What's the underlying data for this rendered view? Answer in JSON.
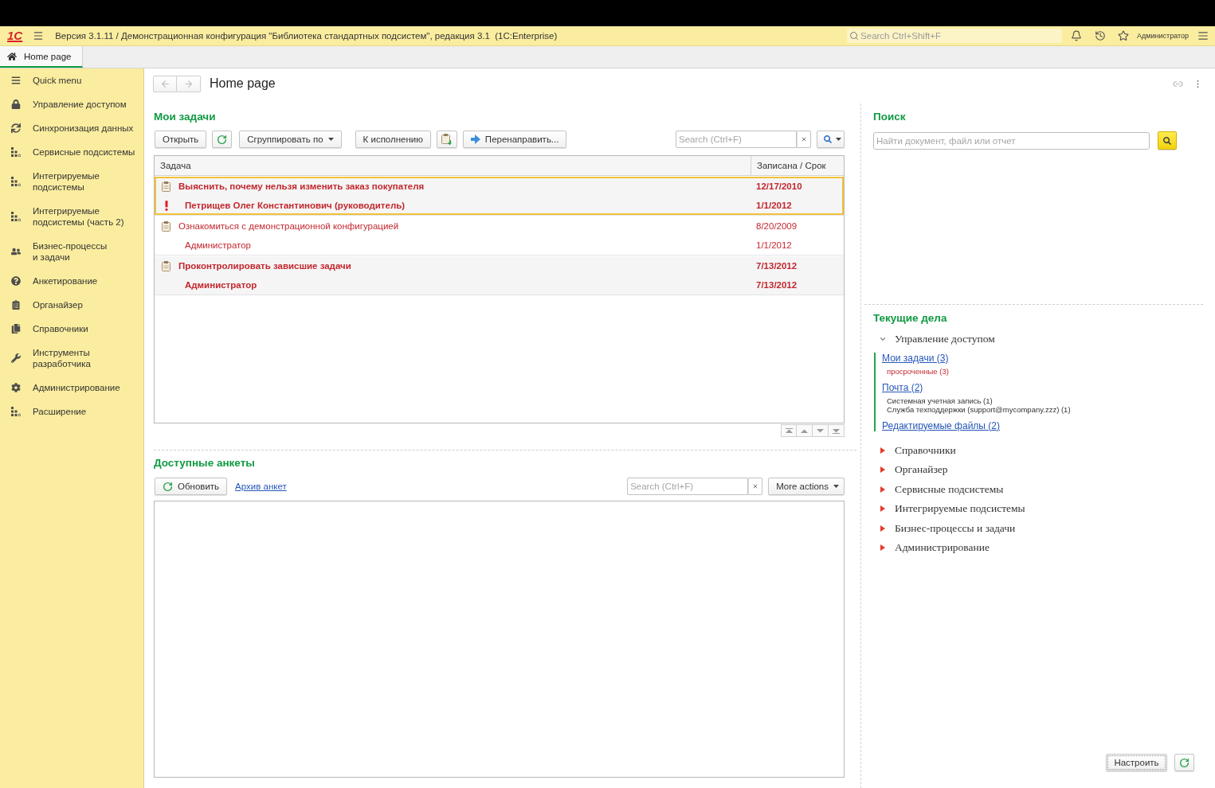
{
  "app_bar": {
    "logo": "1С",
    "title": "Версия 3.1.11 / Демонстрационная конфигурация \"Библиотека стандартных подсистем\", редакция 3.1  (1C:Enterprise)",
    "search": {
      "placeholder": "Search Ctrl+Shift+F"
    },
    "user": "Администратор"
  },
  "tabs": [
    {
      "label": "Home page",
      "selected": true
    }
  ],
  "sidebar": {
    "items": [
      {
        "label": "Quick menu"
      },
      {
        "label": "Управление доступом"
      },
      {
        "label": "Синхронизация данных"
      },
      {
        "label": "Сервисные подсистемы"
      },
      {
        "label": "Интегрируемые подсистемы"
      },
      {
        "label": "Интегрируемые подсистемы (часть 2)"
      },
      {
        "label": "Бизнес-процессы\nи задачи"
      },
      {
        "label": "Анкетирование"
      },
      {
        "label": "Органайзер"
      },
      {
        "label": "Справочники"
      },
      {
        "label": "Инструменты разработчика"
      },
      {
        "label": "Администрирование"
      },
      {
        "label": "Расширение"
      }
    ]
  },
  "page": {
    "title": "Home page"
  },
  "tasks": {
    "title": "Мои задачи",
    "toolbar": {
      "open": "Открыть",
      "group_by": "Сгруппировать по",
      "execute": "К исполнению",
      "forward": "Перенаправить...",
      "search": {
        "placeholder": "Search (Ctrl+F)"
      }
    },
    "table": {
      "columns": [
        "Задача",
        "Записана / Срок"
      ],
      "rows": [
        {
          "task": "Выяснить, почему нельзя изменить заказ покупателя",
          "performer": "Петрищев Олег Константинович (руководитель)",
          "date": "12/17/2010",
          "due": "1/1/2012",
          "bold": true,
          "important": true,
          "overdue": true,
          "selected": true
        },
        {
          "task": "Ознакомиться с демонстрационной конфигурацией",
          "performer": "Администратор",
          "date": "8/20/2009",
          "due": "1/1/2012",
          "bold": false,
          "important": false,
          "overdue": true,
          "selected": false
        },
        {
          "task": "Проконтролировать зависшие задачи",
          "performer": "Администратор",
          "date": "7/13/2012",
          "due": "7/13/2012",
          "bold": true,
          "important": false,
          "overdue": true,
          "selected": false
        }
      ]
    }
  },
  "surveys": {
    "title": "Доступные анкеты",
    "toolbar": {
      "refresh": "Обновить",
      "archive_link": "Архив анкет",
      "search": {
        "placeholder": "Search (Ctrl+F)"
      },
      "more": "More actions"
    }
  },
  "search_panel": {
    "title": "Поиск",
    "placeholder": "Найти документ, файл или отчет"
  },
  "current_tasks": {
    "title": "Текущие дела",
    "sections": [
      {
        "label": "Управление доступом",
        "expanded": true,
        "children": [
          {
            "label": "Мои задачи (3)",
            "details": [
              {
                "text": "просроченные (3)",
                "overdue": true
              }
            ]
          },
          {
            "label": "Почта (2)",
            "details": [
              {
                "text": "Системная учетная запись (1)",
                "overdue": false
              },
              {
                "text": "Служба техподдержки (support@mycompany.zzz) (1)",
                "overdue": false
              }
            ]
          },
          {
            "label": "Редактируемые файлы (2)"
          }
        ]
      },
      {
        "label": "Справочники",
        "expanded": false
      },
      {
        "label": "Органайзер",
        "expanded": false
      },
      {
        "label": "Сервисные подсистемы",
        "expanded": false
      },
      {
        "label": "Интегрируемые подсистемы",
        "expanded": false
      },
      {
        "label": "Бизнес-процессы и задачи",
        "expanded": false
      },
      {
        "label": "Администрирование",
        "expanded": false
      }
    ]
  },
  "footer": {
    "configure": "Настроить"
  }
}
